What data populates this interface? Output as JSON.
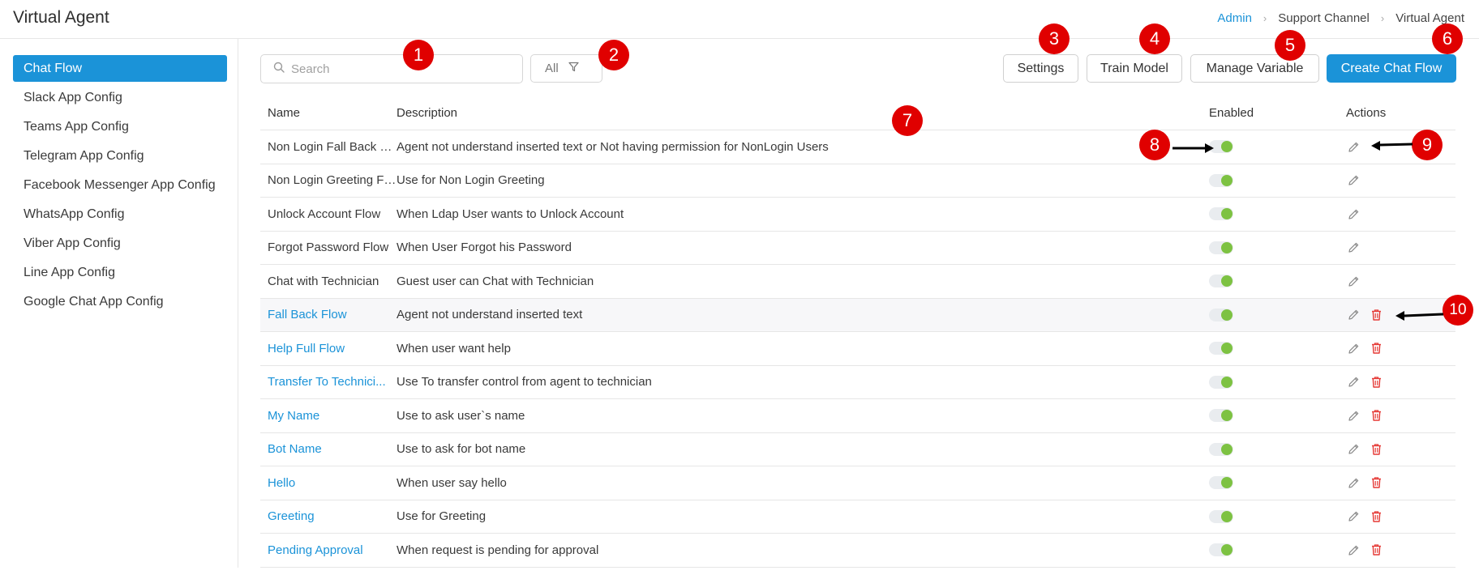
{
  "header": {
    "title": "Virtual Agent",
    "breadcrumb": [
      {
        "label": "Admin",
        "link": true
      },
      {
        "label": "Support Channel",
        "link": false
      },
      {
        "label": "Virtual Agent",
        "link": false
      }
    ],
    "separator": "›"
  },
  "sidebar": {
    "items": [
      {
        "label": "Chat Flow",
        "active": true
      },
      {
        "label": "Slack App Config",
        "active": false
      },
      {
        "label": "Teams App Config",
        "active": false
      },
      {
        "label": "Telegram App Config",
        "active": false
      },
      {
        "label": "Facebook Messenger App Config",
        "active": false
      },
      {
        "label": "WhatsApp Config",
        "active": false
      },
      {
        "label": "Viber App Config",
        "active": false
      },
      {
        "label": "Line App Config",
        "active": false
      },
      {
        "label": "Google Chat App Config",
        "active": false
      }
    ]
  },
  "toolbar": {
    "search_placeholder": "Search",
    "search_value": "",
    "filter_label": "All",
    "settings_label": "Settings",
    "train_label": "Train Model",
    "manage_label": "Manage Variable",
    "create_label": "Create Chat Flow"
  },
  "table": {
    "headers": {
      "name": "Name",
      "description": "Description",
      "enabled": "Enabled",
      "actions": "Actions"
    },
    "rows": [
      {
        "name": "Non Login Fall Back Fl...",
        "description": "Agent not understand inserted text or Not having permission for NonLogin Users",
        "enabled": true,
        "system": true,
        "deletable": false
      },
      {
        "name": "Non Login Greeting Fl...",
        "description": "Use for Non Login Greeting",
        "enabled": true,
        "system": true,
        "deletable": false
      },
      {
        "name": "Unlock Account Flow",
        "description": "When Ldap User wants to Unlock Account",
        "enabled": true,
        "system": true,
        "deletable": false
      },
      {
        "name": "Forgot Password Flow",
        "description": "When User Forgot his Password",
        "enabled": true,
        "system": true,
        "deletable": false
      },
      {
        "name": "Chat with Technician",
        "description": "Guest user can Chat with Technician",
        "enabled": true,
        "system": true,
        "deletable": false
      },
      {
        "name": "Fall Back Flow",
        "description": "Agent not understand inserted text",
        "enabled": true,
        "system": false,
        "deletable": true
      },
      {
        "name": "Help Full Flow",
        "description": "When user want help",
        "enabled": true,
        "system": false,
        "deletable": true
      },
      {
        "name": "Transfer To Technici...",
        "description": "Use To transfer control from agent to technician",
        "enabled": true,
        "system": false,
        "deletable": true
      },
      {
        "name": "My Name",
        "description": "Use to ask user`s name",
        "enabled": true,
        "system": false,
        "deletable": true
      },
      {
        "name": "Bot Name",
        "description": "Use to ask for bot name",
        "enabled": true,
        "system": false,
        "deletable": true
      },
      {
        "name": "Hello",
        "description": "When user say hello",
        "enabled": true,
        "system": false,
        "deletable": true
      },
      {
        "name": "Greeting",
        "description": "Use for Greeting",
        "enabled": true,
        "system": false,
        "deletable": true
      },
      {
        "name": "Pending Approval",
        "description": "When request is pending for approval",
        "enabled": true,
        "system": false,
        "deletable": true
      }
    ]
  },
  "callouts": [
    "1",
    "2",
    "3",
    "4",
    "5",
    "6",
    "7",
    "8",
    "9",
    "10"
  ],
  "colors": {
    "accent": "#1b93d8",
    "toggle_on": "#7dc242",
    "delete": "#e53935",
    "callout": "#e00000"
  }
}
